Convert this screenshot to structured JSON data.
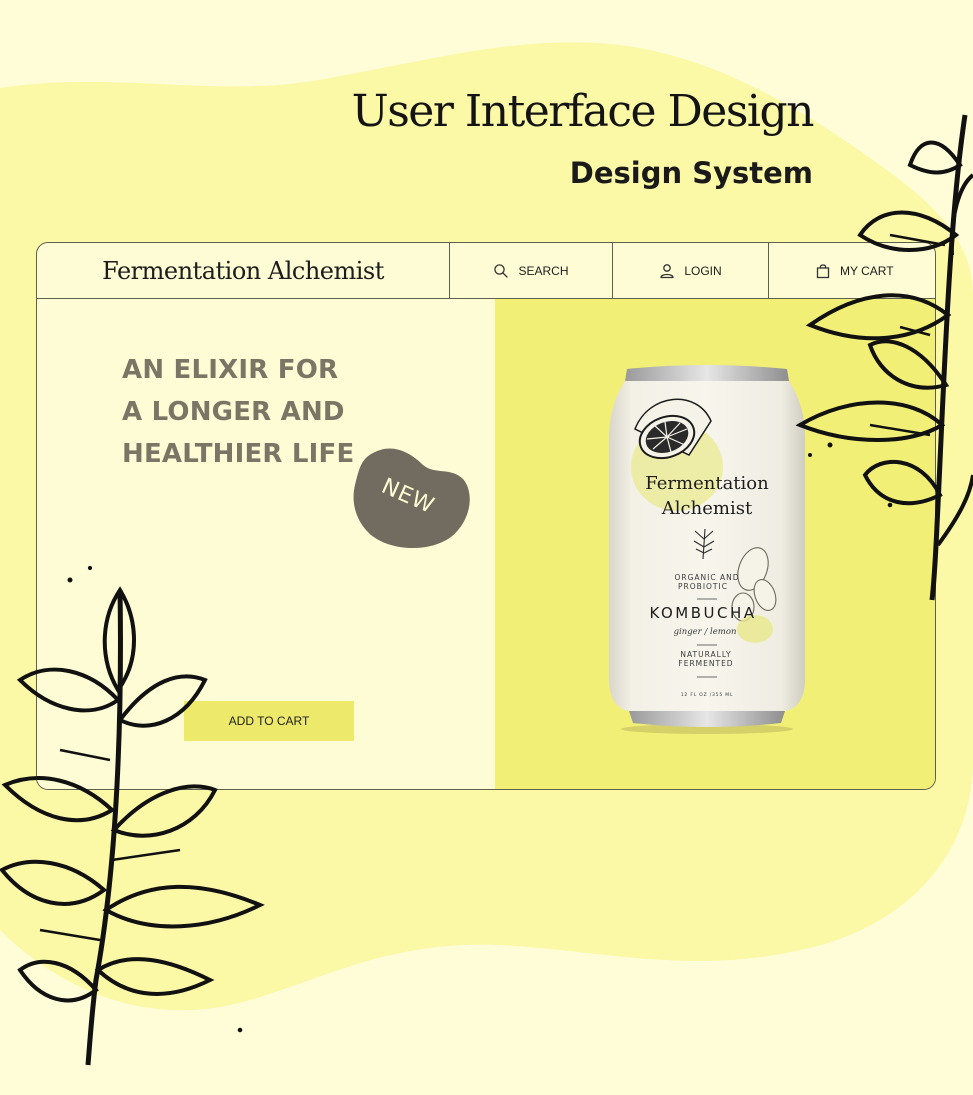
{
  "header": {
    "title": "User Interface Design",
    "subtitle": "Design System"
  },
  "nav": {
    "brand": "Fermentation Alchemist",
    "search_label": "SEARCH",
    "login_label": "LOGIN",
    "cart_label": "MY CART"
  },
  "hero": {
    "headline": [
      "AN ELIXIR FOR",
      "A LONGER AND",
      "HEALTHIER LIFE"
    ],
    "badge": "NEW",
    "cta_label": "ADD TO CART"
  },
  "product": {
    "brand_line1": "Fermentation",
    "brand_line2": "Alchemist",
    "tagline1": "ORGANIC AND",
    "tagline2": "PROBIOTIC",
    "name": "KOMBUCHA",
    "flavor": "ginger / lemon",
    "note1": "NATURALLY",
    "note2": "FERMENTED",
    "volume": "12 FL OZ /355 ML"
  },
  "icons": [
    "search-icon",
    "user-icon",
    "shopping-bag-icon",
    "lemon-illustration",
    "ginger-illustration",
    "herb-sprig-illustration",
    "leaf-branch-illustration"
  ],
  "colors": {
    "page_bg": "#fefdd8",
    "blob": "#fbf8a6",
    "hero_yellow": "#f2ef76",
    "headline_gray": "#7a7565",
    "badge_dark": "#716c5f",
    "button": "#ede96a",
    "ink": "#141414"
  }
}
